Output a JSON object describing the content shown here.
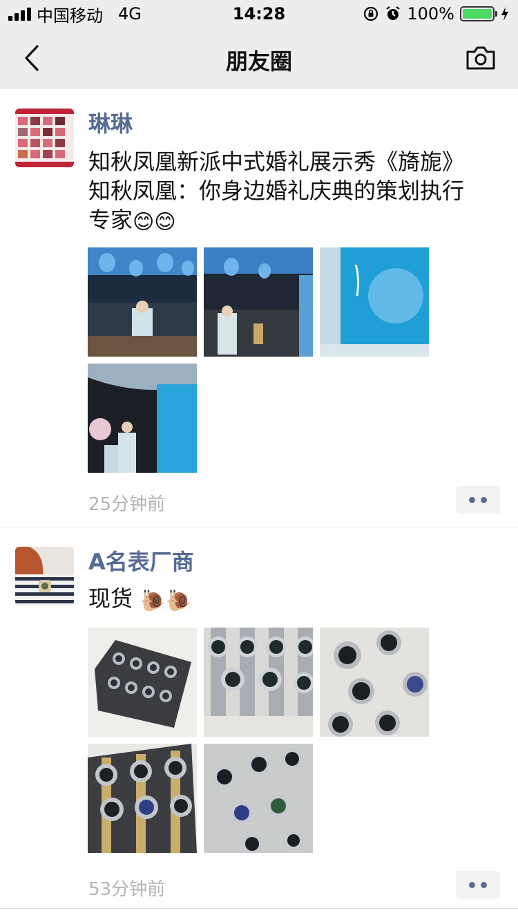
{
  "status_bar": {
    "carrier": "中国移动",
    "network": "4G",
    "time": "14:28",
    "battery_percent": "100%",
    "battery_level": 1.0,
    "icons": [
      "signal-icon",
      "orientation-lock-icon",
      "alarm-icon",
      "battery-icon",
      "charging-icon"
    ]
  },
  "nav": {
    "title": "朋友圈",
    "back_icon": "chevron-left-icon",
    "camera_icon": "camera-icon"
  },
  "posts": [
    {
      "username": "琳琳",
      "text_lines": [
        "知秋凤凰新派中式婚礼展示秀《旖旎》",
        "知秋凤凰：你身边婚礼庆典的策划执行",
        "专家"
      ],
      "emojis": [
        "😊",
        "😊"
      ],
      "photo_count": 4,
      "timestamp": "25分钟前"
    },
    {
      "username": "A名表厂商",
      "text": "现货",
      "emojis": [
        "🐌",
        "🐌"
      ],
      "photo_count": 5,
      "timestamp": "53分钟前"
    }
  ],
  "colors": {
    "username": "#576b95",
    "bar_background": "#ededed",
    "timestamp": "#b2b2b2",
    "battery": "#4cd964"
  }
}
